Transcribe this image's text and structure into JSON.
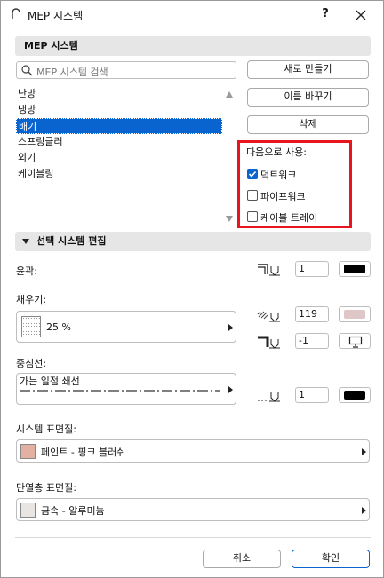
{
  "window": {
    "title": "MEP 시스템",
    "help": "?"
  },
  "mep_section": {
    "title": "MEP 시스템"
  },
  "search": {
    "placeholder": "MEP 시스템 검색"
  },
  "buttons": {
    "new": "새로 만들기",
    "rename": "이름 바꾸기",
    "delete": "삭제"
  },
  "systems": [
    {
      "label": "난방",
      "selected": false
    },
    {
      "label": "냉방",
      "selected": false
    },
    {
      "label": "배기",
      "selected": true
    },
    {
      "label": "스프링클러",
      "selected": false
    },
    {
      "label": "외기",
      "selected": false
    },
    {
      "label": "케이블링",
      "selected": false
    }
  ],
  "use_for": {
    "label": "다음으로 사용:",
    "options": [
      {
        "label": "덕트워크",
        "checked": true
      },
      {
        "label": "파이프워크",
        "checked": false
      },
      {
        "label": "케이블 트레이",
        "checked": false
      }
    ]
  },
  "edit_section": {
    "title": "선택 시스템 편집"
  },
  "contour": {
    "label": "윤곽:",
    "pen": "1",
    "pen_color": "#000000"
  },
  "fill": {
    "label": "채우기:",
    "value": "25 %",
    "fg_pen": "119",
    "fg_color": "#e0c7c7",
    "bg_pen": "-1"
  },
  "centerline": {
    "label": "중심선:",
    "value": "가는 일점 쇄선",
    "pen": "1",
    "pen_color": "#000000"
  },
  "system_surface": {
    "label": "시스템 표면질:",
    "value": "페인트 - 핑크 블러쉬",
    "color": "#e3b0a2"
  },
  "insulation_surface": {
    "label": "단열층 표면질:",
    "value": "금속 - 알루미늄",
    "color": "#e9e5e3"
  },
  "footer": {
    "cancel": "취소",
    "ok": "확인"
  }
}
